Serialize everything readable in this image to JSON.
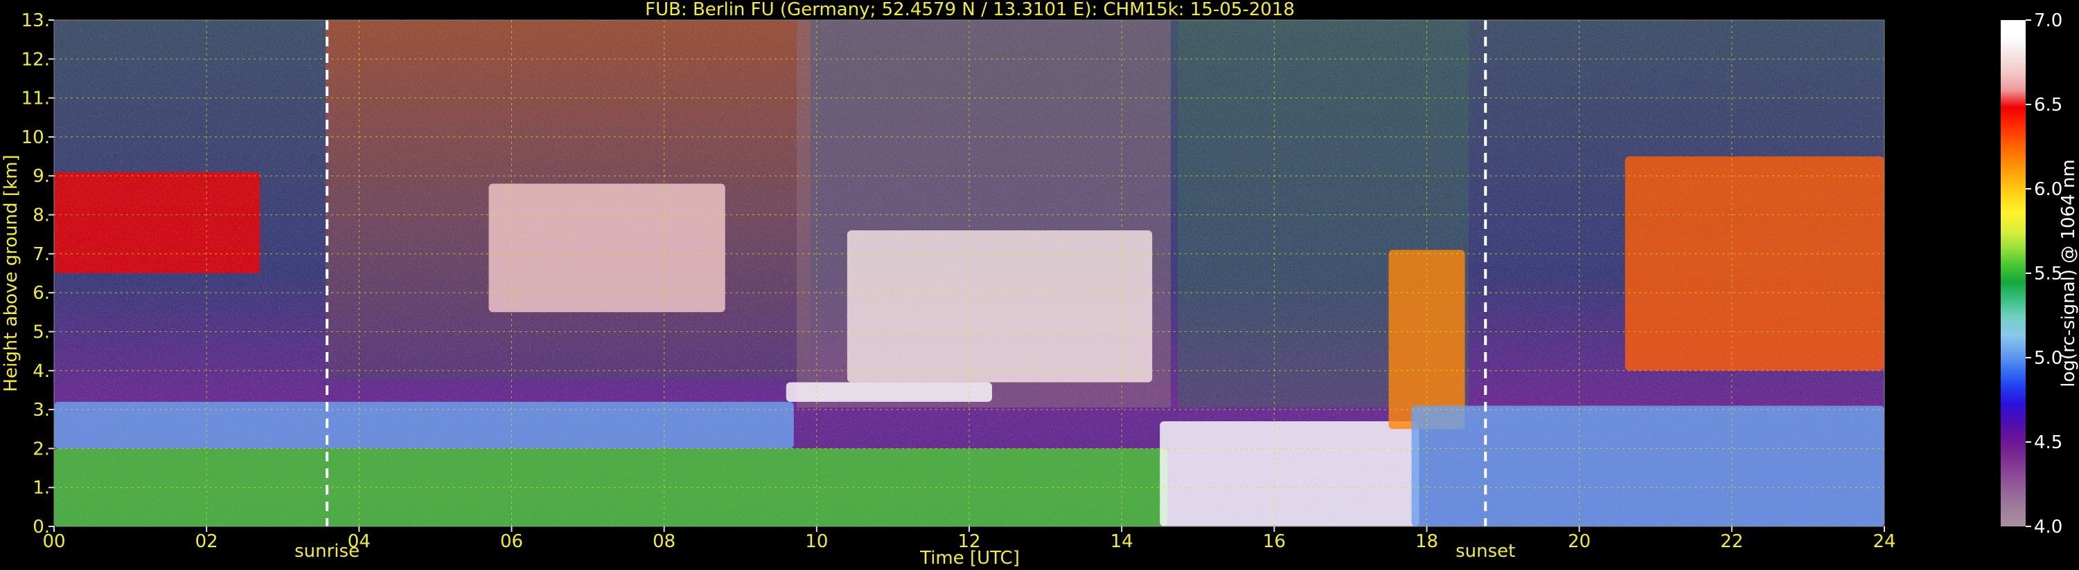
{
  "chart_data": {
    "type": "heatmap",
    "title": "FUB: Berlin FU (Germany; 52.4579 N / 13.3101 E):    CHM15k: 15-05-2018",
    "xlabel": "Time [UTC]",
    "ylabel": "Height above ground [km]",
    "x_ticks": [
      "00",
      "02",
      "04",
      "06",
      "08",
      "10",
      "12",
      "14",
      "16",
      "18",
      "20",
      "22",
      "24"
    ],
    "y_ticks": [
      "0.",
      "1.",
      "2.",
      "3.",
      "4.",
      "5.",
      "6.",
      "7.",
      "8.",
      "9.",
      "10.",
      "11.",
      "12.",
      "13."
    ],
    "xlim": [
      0,
      24
    ],
    "ylim": [
      0,
      13
    ],
    "grid": true,
    "events": [
      {
        "label": "sunrise",
        "time_utc": 3.58
      },
      {
        "label": "sunset",
        "time_utc": 18.77
      }
    ],
    "colorbar": {
      "label": "log(rc-signal) @ 1064 nm",
      "ticks": [
        "4.0",
        "4.5",
        "5.0",
        "5.5",
        "6.0",
        "6.5",
        "7.0"
      ],
      "range": [
        4.0,
        7.0
      ],
      "colors": [
        "#a890a0",
        "#a07e9a",
        "#96649a",
        "#8a4996",
        "#7a2c92",
        "#6a1496",
        "#4c0eb2",
        "#2c10dc",
        "#1f3ef2",
        "#3c74f2",
        "#6aa2ee",
        "#8cc8ea",
        "#72d0c0",
        "#38c082",
        "#14a83c",
        "#48c832",
        "#9ee23a",
        "#dff03a",
        "#fff22a",
        "#ffd418",
        "#ffae0c",
        "#ff8406",
        "#ff5a04",
        "#ff2a02",
        "#f00000",
        "#ee9a9a",
        "#f3c8c8",
        "#f6e4e4",
        "#ffffff",
        "#ffffff"
      ]
    },
    "signal_features": [
      {
        "kind": "boundary_layer",
        "t_start": 0,
        "t_end": 14.6,
        "h_bottom": 0,
        "h_top": 2.0,
        "level": 5.5
      },
      {
        "kind": "residual_layer",
        "t_start": 0,
        "t_end": 9.7,
        "h_bottom": 2.0,
        "h_top": 3.2,
        "level": 5.0
      },
      {
        "kind": "cirrus",
        "t_start": 0,
        "t_end": 2.7,
        "h_bottom": 6.5,
        "h_top": 9.1,
        "level": 6.5
      },
      {
        "kind": "cirrus",
        "t_start": 5.7,
        "t_end": 8.8,
        "h_bottom": 5.5,
        "h_top": 8.8,
        "level": 6.7
      },
      {
        "kind": "aerosol_layer",
        "t_start": 9.6,
        "t_end": 12.3,
        "h_bottom": 3.2,
        "h_top": 3.7,
        "level": 7.0
      },
      {
        "kind": "cloud",
        "t_start": 10.4,
        "t_end": 14.4,
        "h_bottom": 3.7,
        "h_top": 7.6,
        "level": 6.8
      },
      {
        "kind": "low_cloud",
        "t_start": 14.5,
        "t_end": 17.9,
        "h_bottom": 0,
        "h_top": 2.7,
        "level": 7.0
      },
      {
        "kind": "cloud",
        "t_start": 17.5,
        "t_end": 18.5,
        "h_bottom": 2.5,
        "h_top": 7.1,
        "level": 6.2
      },
      {
        "kind": "boundary_layer",
        "t_start": 17.8,
        "t_end": 24,
        "h_bottom": 0,
        "h_top": 3.1,
        "level": 5.0
      },
      {
        "kind": "cirrus",
        "t_start": 20.6,
        "t_end": 24,
        "h_bottom": 4.0,
        "h_top": 9.5,
        "level": 6.3
      }
    ]
  }
}
